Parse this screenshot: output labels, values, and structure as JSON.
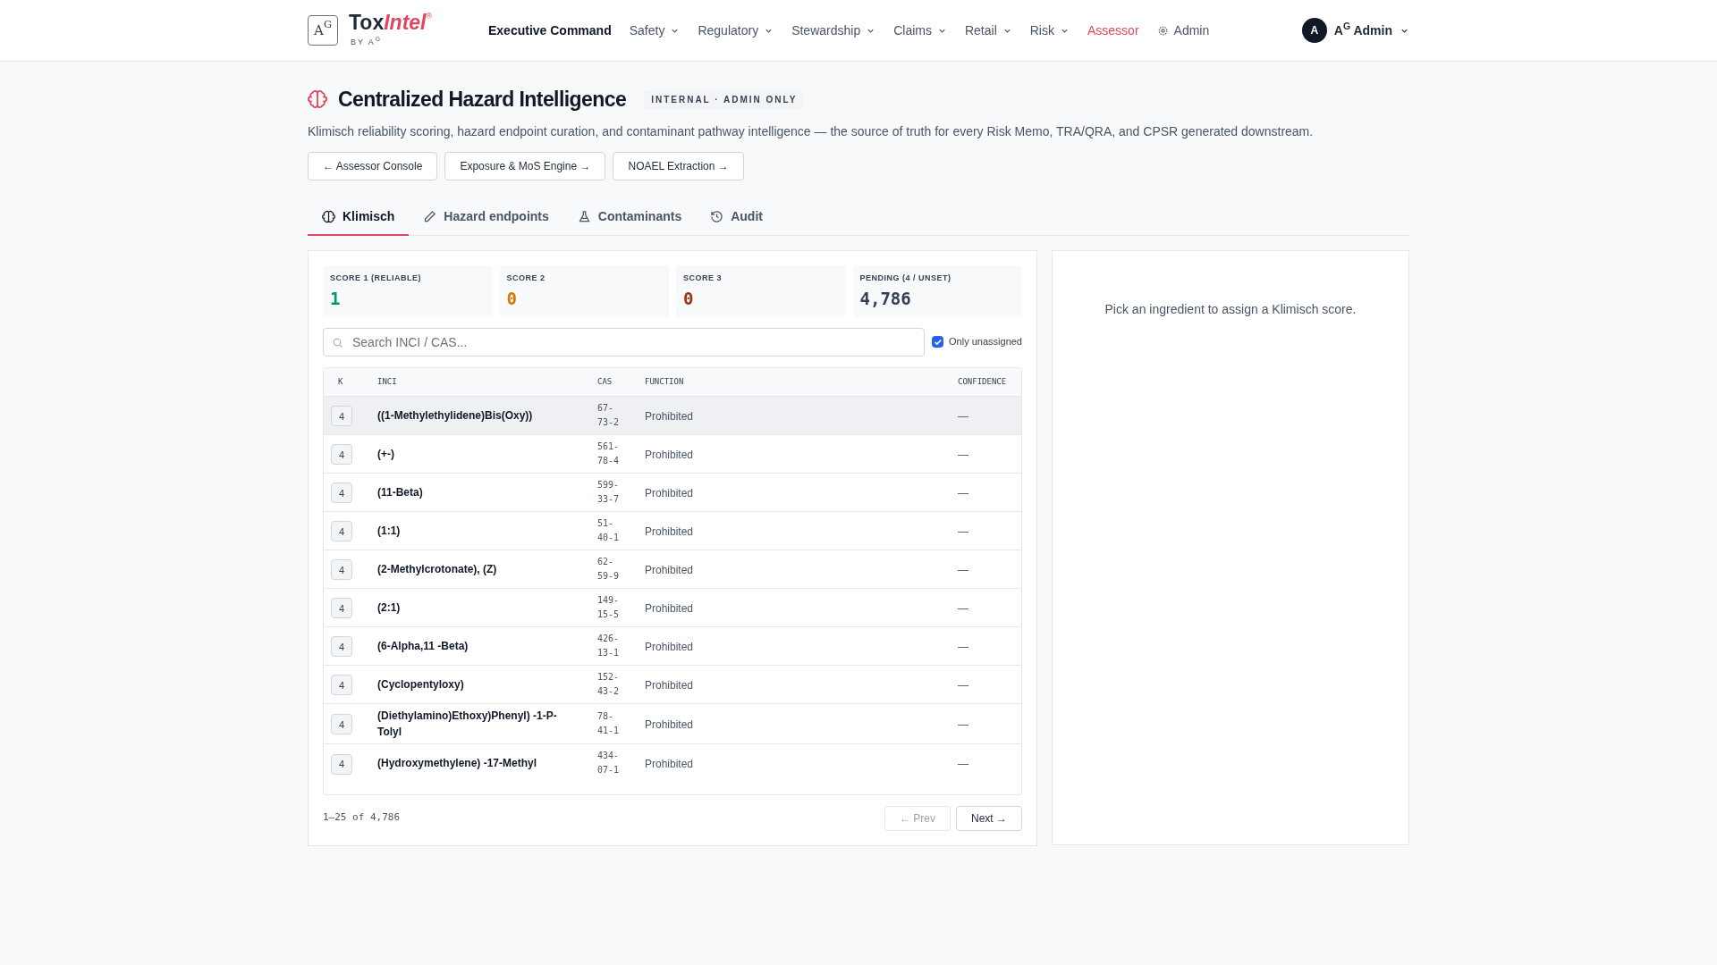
{
  "brand": {
    "name": "Tox",
    "name_accent": "Intel",
    "mark": "®",
    "byline": "BY A$^{G}$",
    "logo_text": "A$^{G}$"
  },
  "nav": [
    {
      "label": "Executive Command",
      "kind": "primary",
      "selected": false
    },
    {
      "label": "Safety",
      "kind": "dropdown",
      "selected": false
    },
    {
      "label": "Regulatory",
      "kind": "dropdown",
      "selected": false
    },
    {
      "label": "Stewardship",
      "kind": "dropdown",
      "selected": false
    },
    {
      "label": "Claims",
      "kind": "dropdown",
      "selected": false
    },
    {
      "label": "Retail",
      "kind": "dropdown",
      "selected": false
    },
    {
      "label": "Risk",
      "kind": "dropdown",
      "selected": false
    },
    {
      "label": "Assessor",
      "kind": "link",
      "selected": true
    },
    {
      "label": "Admin",
      "kind": "settings",
      "selected": false
    }
  ],
  "user": {
    "initial": "A",
    "name": "A$^{G}$ Admin"
  },
  "page": {
    "title": "Centralized Hazard Intelligence",
    "badge": "INTERNAL · ADMIN ONLY",
    "description": "Klimisch reliability scoring, hazard endpoint curation, and contaminant pathway intelligence — the source of truth for every Risk Memo, TRA/QRA, and CPSR generated downstream."
  },
  "links": [
    "← Assessor Console",
    "Exposure & MoS Engine →",
    "NOAEL Extraction →"
  ],
  "tabs": [
    {
      "label": "Klimisch",
      "selected": true
    },
    {
      "label": "Hazard endpoints",
      "selected": false
    },
    {
      "label": "Contaminants",
      "selected": false
    },
    {
      "label": "Audit",
      "selected": false
    }
  ],
  "stats": [
    {
      "label": "SCORE 1 (RELIABLE)",
      "value": "1",
      "color": "#059669"
    },
    {
      "label": "SCORE 2",
      "value": "0",
      "color": "#d97706"
    },
    {
      "label": "SCORE 3",
      "value": "0",
      "color": "#9a3412"
    },
    {
      "label": "PENDING (4 / UNSET)",
      "value": "4,786",
      "color": "#334155"
    }
  ],
  "search": {
    "placeholder": "Search INCI / CAS..."
  },
  "filter": {
    "label": "Only unassigned",
    "checked": true
  },
  "table": {
    "columns": [
      "K",
      "INCI",
      "CAS",
      "FUNCTION",
      "CONFIDENCE"
    ],
    "rows": [
      {
        "k": "4",
        "inci": "((1-Methylethylidene)Bis(Oxy))",
        "cas": [
          "67-",
          "73-2"
        ],
        "function": "Prohibited",
        "confidence": "—",
        "selected": true
      },
      {
        "k": "4",
        "inci": "(+-)",
        "cas": [
          "561-",
          "78-4"
        ],
        "function": "Prohibited",
        "confidence": "—",
        "selected": false
      },
      {
        "k": "4",
        "inci": "(11-Beta)",
        "cas": [
          "599-",
          "33-7"
        ],
        "function": "Prohibited",
        "confidence": "—",
        "selected": false
      },
      {
        "k": "4",
        "inci": "(1:1)",
        "cas": [
          "51-",
          "40-1"
        ],
        "function": "Prohibited",
        "confidence": "—",
        "selected": false
      },
      {
        "k": "4",
        "inci": "(2-Methylcrotonate), (Z)",
        "cas": [
          "62-",
          "59-9"
        ],
        "function": "Prohibited",
        "confidence": "—",
        "selected": false
      },
      {
        "k": "4",
        "inci": "(2:1)",
        "cas": [
          "149-",
          "15-5"
        ],
        "function": "Prohibited",
        "confidence": "—",
        "selected": false
      },
      {
        "k": "4",
        "inci": "(6-Alpha,11 -Beta)",
        "cas": [
          "426-",
          "13-1"
        ],
        "function": "Prohibited",
        "confidence": "—",
        "selected": false
      },
      {
        "k": "4",
        "inci": "(Cyclopentyloxy)",
        "cas": [
          "152-",
          "43-2"
        ],
        "function": "Prohibited",
        "confidence": "—",
        "selected": false
      },
      {
        "k": "4",
        "inci": "(Diethylamino)Ethoxy)Phenyl) -1-P-Tolyl",
        "cas": [
          "78-",
          "41-1"
        ],
        "function": "Prohibited",
        "confidence": "—",
        "selected": false
      },
      {
        "k": "4",
        "inci": "(Hydroxymethylene) -17-Methyl",
        "cas": [
          "434-",
          "07-1"
        ],
        "function": "Prohibited",
        "confidence": "—",
        "selected": false
      }
    ]
  },
  "pagination": {
    "range": "1–25 of 4,786",
    "prev": {
      "label": "← Prev",
      "disabled": true
    },
    "next": {
      "label": "Next →",
      "disabled": false
    }
  },
  "detail": {
    "empty_text": "Pick an ingredient to assign a Klimisch score."
  }
}
